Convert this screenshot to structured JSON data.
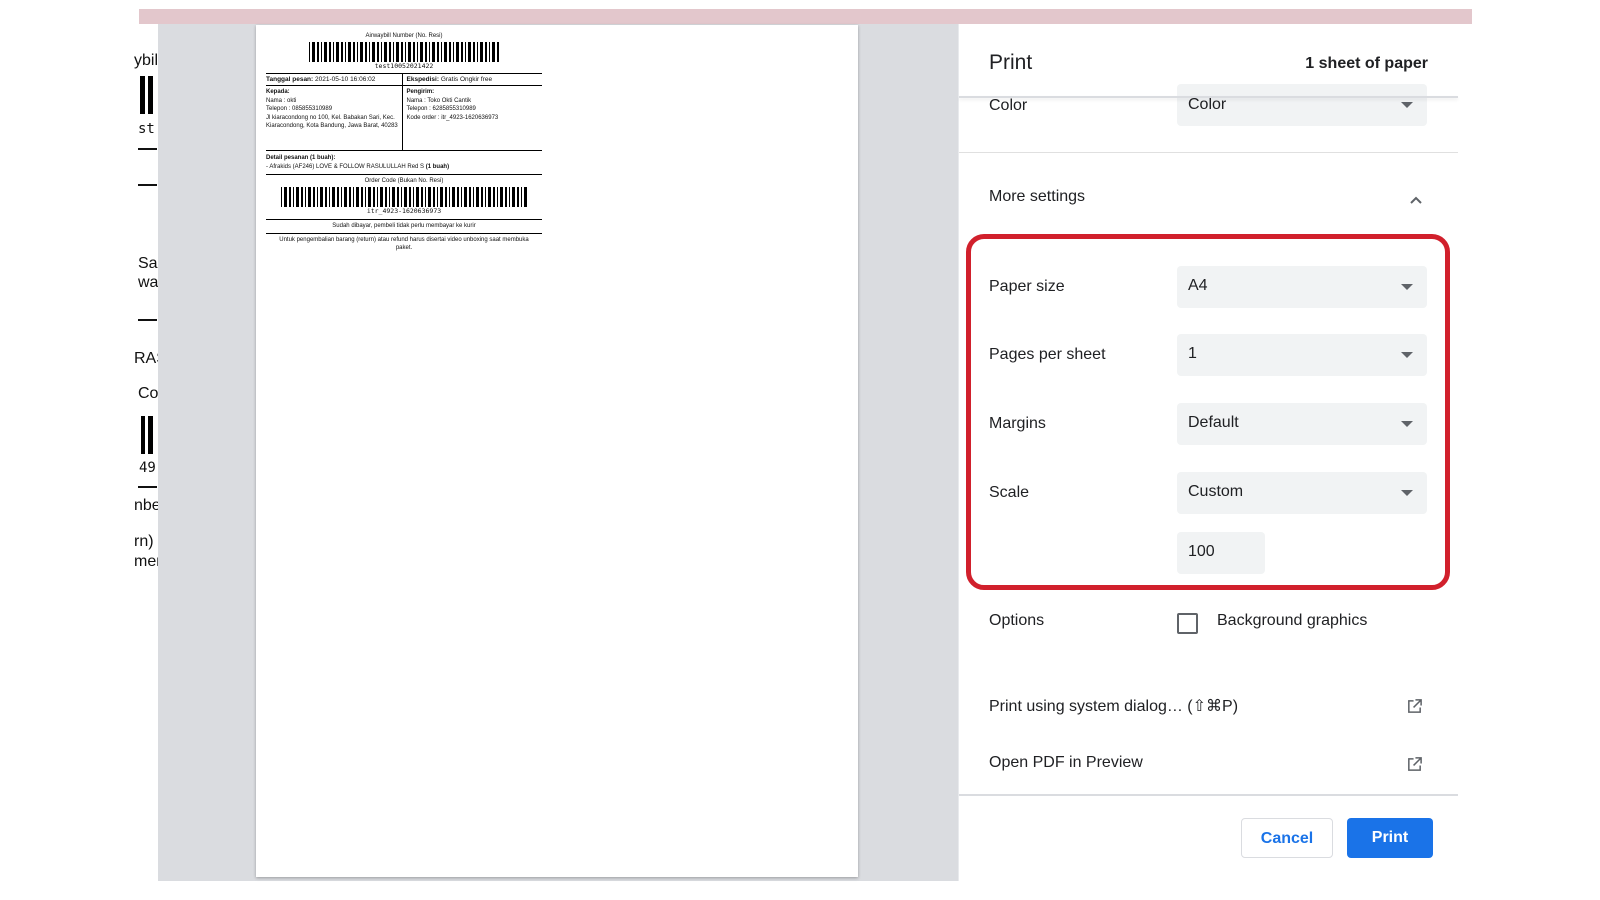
{
  "background_page": {
    "fragments": [
      "ybill",
      "st",
      "Sa",
      "wa",
      "RAS",
      "Co",
      "49",
      "nbe",
      "rn)",
      "mer"
    ]
  },
  "preview": {
    "awb_title": "Airwaybill Number (No. Resi)",
    "awb_number": "test10052021422",
    "date_label": "Tanggal pesan:",
    "date_value": "2021-05-10 16:06:02",
    "expedition_label": "Ekspedisi:",
    "expedition_value": "Gratis Ongkir free",
    "to_label": "Kepada:",
    "to_name": "Nama     : okti",
    "to_phone": "Telepon : 085855310989",
    "to_address": "Jl kiaracondong no 100, Kel. Babakan Sari, Kec. Kiaracondong, Kota Bandung, Jawa Barat, 40283",
    "from_label": "Pengirim:",
    "from_name": "Nama       : Toko Okti Cantik",
    "from_phone": "Telepon     : 6285855310989",
    "from_order": "Kode order : itr_4923-1620636973",
    "detail_label": "Detail pesanan (1 buah):",
    "detail_item": "- Afrakids (AF246) LOVE & FOLLOW RASULULLAH Red S",
    "detail_qty": "(1 buah)",
    "order_code_title": "Order Code (Bukan No. Resi)",
    "order_code": "itr_4923-1620636973",
    "paid_note": "Sudah dibayar, pembeli tidak perlu membayar ke kurir",
    "return_note": "Untuk pengembalian barang (return) atau refund harus disertai video unboxing saat membuka paket."
  },
  "panel": {
    "title": "Print",
    "sheets": "1 sheet of paper",
    "color_label": "Color",
    "color_value": "Color",
    "more_settings": "More settings",
    "paper_size_label": "Paper size",
    "paper_size_value": "A4",
    "pages_per_sheet_label": "Pages per sheet",
    "pages_per_sheet_value": "1",
    "margins_label": "Margins",
    "margins_value": "Default",
    "scale_label": "Scale",
    "scale_value": "Custom",
    "scale_number": "100",
    "options_label": "Options",
    "background_graphics": "Background graphics",
    "system_dialog": "Print using system dialog… (⇧⌘P)",
    "open_pdf": "Open PDF in Preview",
    "cancel": "Cancel",
    "print": "Print"
  },
  "colors": {
    "accent": "#1a73e8",
    "highlight": "#d1202c",
    "preview_bg": "#dadce0"
  },
  "icons": [
    "chevron-up-icon",
    "caret-down-icon",
    "open-external-icon",
    "checkbox-icon"
  ]
}
